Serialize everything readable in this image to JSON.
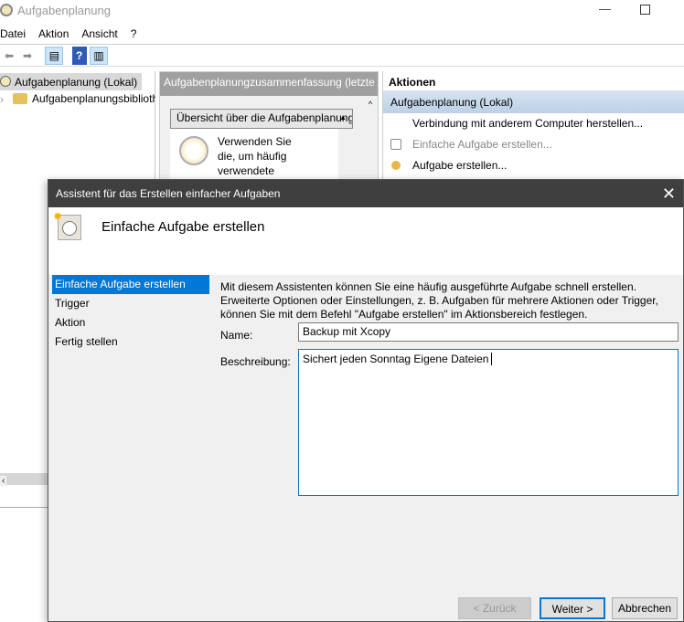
{
  "window": {
    "title": "Aufgabenplanung"
  },
  "menu": [
    "Datei",
    "Aktion",
    "Ansicht",
    "?"
  ],
  "tree": {
    "root": "Aufgabenplanung (Lokal)",
    "child": "Aufgabenplanungsbibliothek"
  },
  "middle": {
    "header": "Aufgabenplanungzusammenfassung (letzte Aktualisierung)",
    "section": "Übersicht über die Aufgabenplanung",
    "text": "Verwenden Sie die, um häufig verwendete"
  },
  "actions": {
    "header": "Aktionen",
    "group": "Aufgabenplanung (Lokal)",
    "items": [
      "Verbindung mit anderem Computer herstellen...",
      "Einfache Aufgabe erstellen...",
      "Aufgabe erstellen..."
    ]
  },
  "dialog": {
    "title": "Assistent für das Erstellen einfacher Aufgaben",
    "heading": "Einfache Aufgabe erstellen",
    "steps": [
      "Einfache Aufgabe erstellen",
      "Trigger",
      "Aktion",
      "Fertig stellen"
    ],
    "intro": [
      "Mit diesem Assistenten können Sie eine häufig ausgeführte Aufgabe schnell erstellen.",
      "Erweiterte Optionen oder Einstellungen, z. B. Aufgaben für mehrere Aktionen oder Trigger,",
      "können Sie mit dem Befehl \"Aufgabe erstellen\" im Aktionsbereich festlegen."
    ],
    "name_label": "Name:",
    "name_value": "Backup mit Xcopy",
    "desc_label": "Beschreibung:",
    "desc_value": "Sichert jeden Sonntag Eigene Dateien",
    "back": "< Zurück",
    "next": "Weiter >",
    "cancel": "Abbrechen"
  }
}
